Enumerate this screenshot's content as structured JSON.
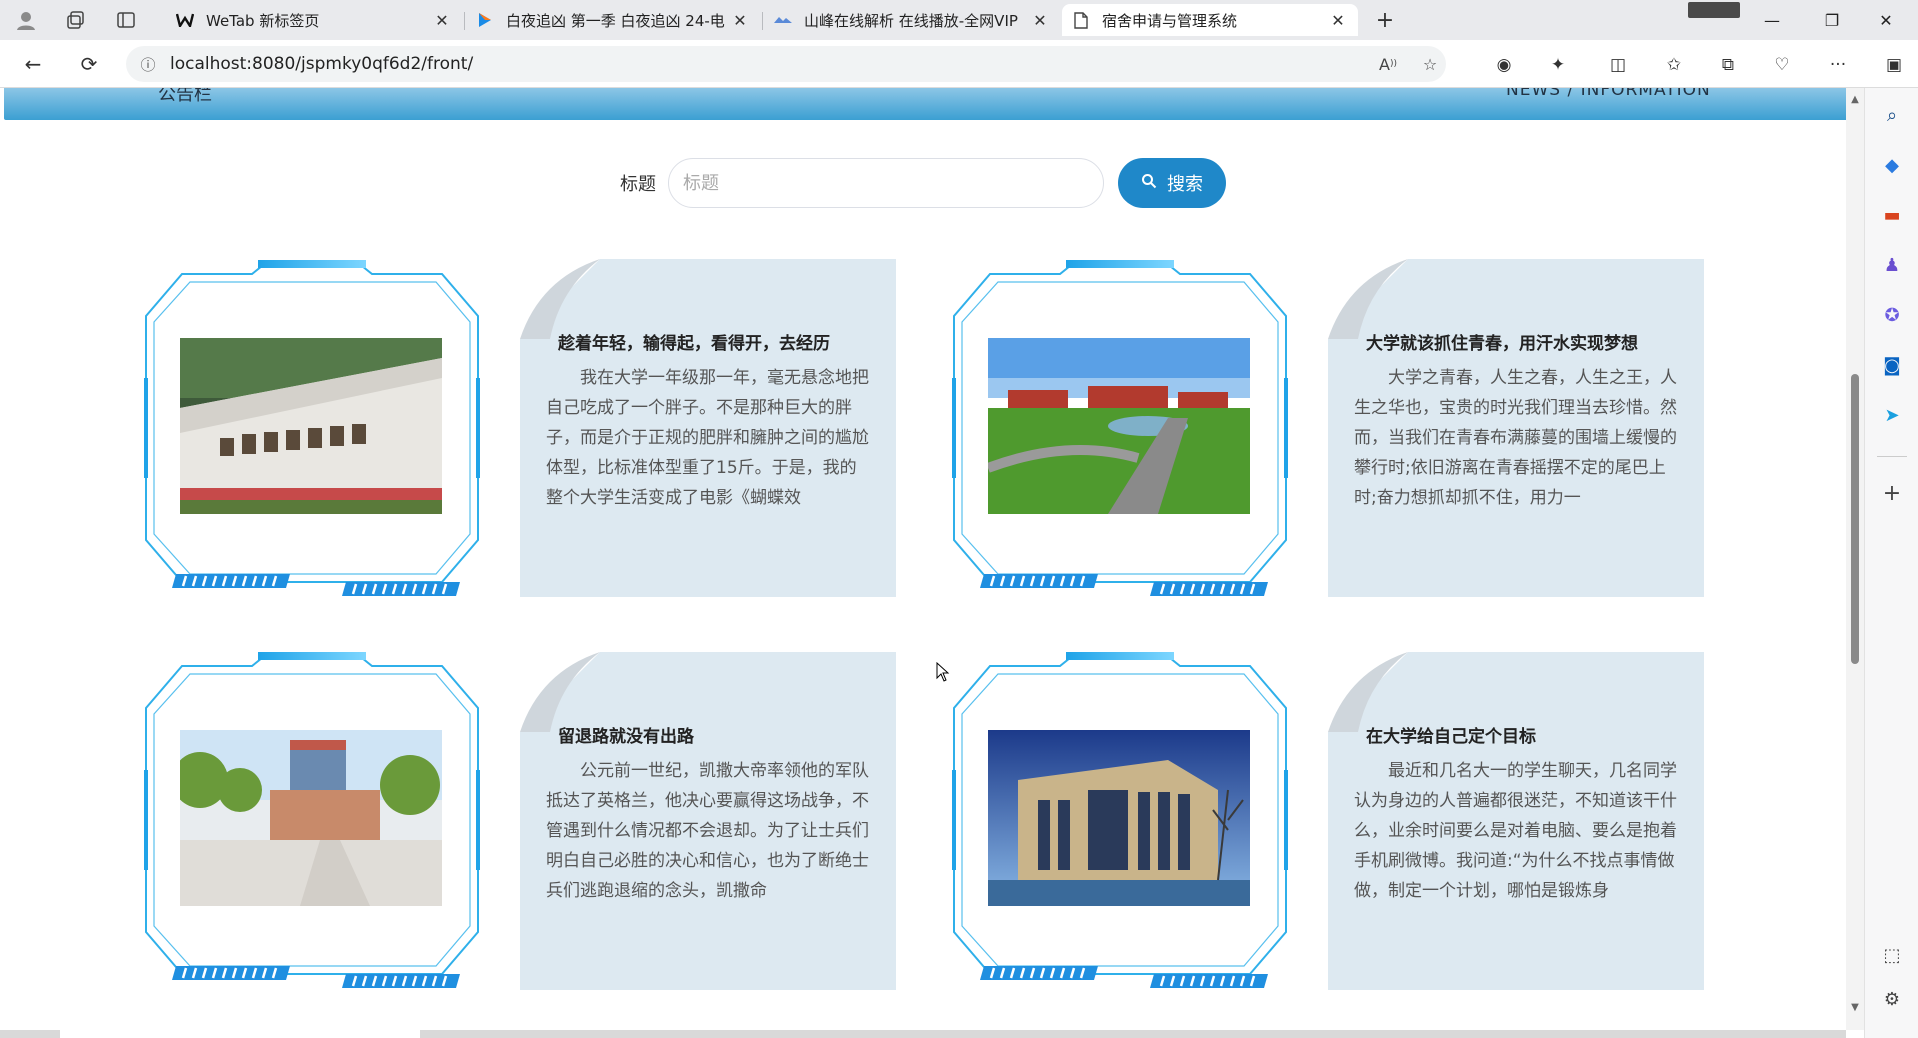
{
  "browser": {
    "tabs": [
      {
        "title": "WeTab 新标签页",
        "favicon": "wetab-icon",
        "active": false
      },
      {
        "title": "白夜追凶 第一季 白夜追凶 24-电",
        "favicon": "play-icon",
        "active": false
      },
      {
        "title": "山峰在线解析 在线播放-全网VIP",
        "favicon": "shanfeng-icon",
        "active": false
      },
      {
        "title": "宿舍申请与管理系统",
        "favicon": "page-icon",
        "active": true
      }
    ],
    "url": "localhost:8080/jspmky0qf6d2/front/"
  },
  "page": {
    "section_left_label": "公告栏",
    "section_right_label": "NEWS / INFORMATION",
    "search": {
      "label": "标题",
      "placeholder": "标题",
      "value": "",
      "button_label": "搜索"
    },
    "news": [
      {
        "title": "趁着年轻，输得起，看得开，去经历",
        "excerpt": "我在大学一年级那一年，毫无悬念地把自己吃成了一个胖子。不是那种巨大的胖子，而是介于正规的肥胖和臃肿之间的尴尬体型，比标准体型重了15斤。于是，我的整个大学生活变成了电影《蝴蝶效",
        "image": "campus-gate-photo"
      },
      {
        "title": "大学就该抓住青春，用汗水实现梦想",
        "excerpt": "大学之青春，人生之春，人生之王，人生之华也，宝贵的时光我们理当去珍惜。然而，当我们在青春布满藤蔓的围墙上缓慢的攀行时;依旧游离在青春摇摆不定的尾巴上时;奋力想抓却抓不住，用力一",
        "image": "campus-aerial-photo"
      },
      {
        "title": "留退路就没有出路",
        "excerpt": "公元前一世纪，凯撒大帝率领他的军队抵达了英格兰，他决心要赢得这场战争，不管遇到什么情况都不会退却。为了让士兵们明白自己必胜的决心和信心，也为了断绝士兵们逃跑退缩的念头，凯撒命",
        "image": "campus-building-photo"
      },
      {
        "title": "在大学给自己定个目标",
        "excerpt": "最近和几名大一的学生聊天，几名同学认为身边的人普遍都很迷茫，不知道该干什么，业余时间要么是对着电脑、要么是抱着手机刷微博。我问道:“为什么不找点事情做做，制定一个计划，哪怕是锻炼身",
        "image": "library-building-photo"
      }
    ]
  },
  "colors": {
    "accent": "#1f88c9",
    "frame": "#2fb0ea",
    "card_bg": "#dde9f1",
    "header_band": "#3b9fd2"
  }
}
